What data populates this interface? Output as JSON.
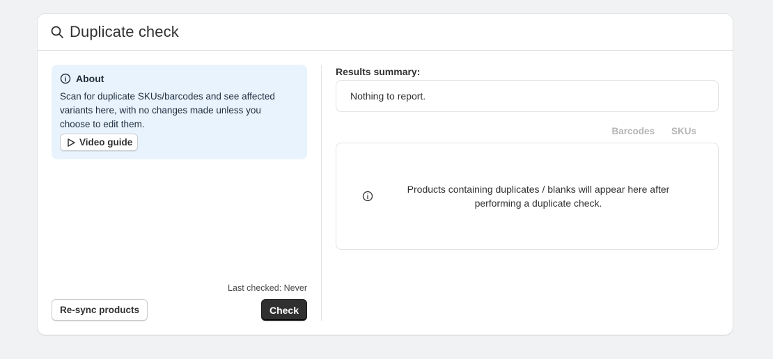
{
  "header": {
    "title": "Duplicate check",
    "icon": "search-icon"
  },
  "about": {
    "title": "About",
    "icon": "info-icon",
    "text": "Scan for duplicate SKUs/barcodes and see affected variants here, with no changes made unless you choose to edit them.",
    "video_label": "Video guide",
    "video_icon": "play-icon"
  },
  "actions": {
    "resync_label": "Re-sync products",
    "last_checked": "Last checked: Never",
    "check_label": "Check"
  },
  "results": {
    "summary_label": "Results summary:",
    "summary_text": "Nothing to report.",
    "tabs": [
      {
        "label": "Barcodes"
      },
      {
        "label": "SKUs"
      }
    ],
    "empty_icon": "info-icon",
    "empty_text": "Products containing duplicates / blanks will appear here after performing a duplicate check."
  },
  "colors": {
    "about_bg": "#e8f3fd",
    "primary_button": "#303030",
    "tab_inactive": "#b5b5b5"
  }
}
